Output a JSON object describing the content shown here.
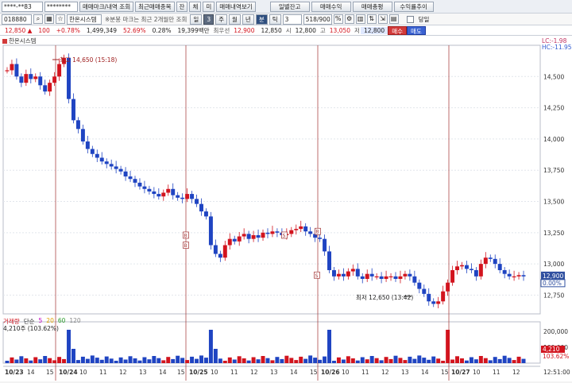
{
  "toolbar1": {
    "account_field": "****-**83",
    "password_field": "********",
    "btn_trade_mark": "매매마크/내역 조회",
    "btn_recent_trades": "최근매매종목",
    "btn_balance": "잔",
    "btn_holdings": "체",
    "btn_not": "미",
    "btn_trade_history": "매매내역보기",
    "btn_daily_balance": "일별잔고",
    "btn_trade_profit": "매매수익",
    "btn_trade_sum": "매매총평",
    "btn_profit_trend": "수익률추이"
  },
  "toolbar2": {
    "code_field": "018880",
    "stock_name": "한온시스템",
    "note": "※분봉 마크는 최근 2개월만 조회",
    "period_buttons": [
      "일",
      "3",
      "주",
      "월",
      "년",
      "분",
      "틱"
    ],
    "selected_period": "3",
    "minute_value": "3",
    "count_value": "518/900",
    "today_label": "당일"
  },
  "quote": {
    "price": "12,850 ▲",
    "change": "100",
    "change_pct": "+0.78%",
    "volume": "1,499,349",
    "turnover_pct": "52.69%",
    "ratio": "0.28%",
    "amount": "19,399백만",
    "best_ask_label": "최우선",
    "best_ask": "12,900",
    "prev_close": "12,850",
    "open_label": "시",
    "open": "12,800",
    "high_label": "고",
    "high": "13,050",
    "low_label": "저",
    "low": "12,800",
    "buy": "매수",
    "sell": "매도"
  },
  "chart": {
    "legend_name": "한온시스템",
    "lc": "LC:-1.98",
    "hc": "HC:-11.95",
    "high_annotation": "최고 14,650 (15:18)",
    "low_annotation": "최저 12,650 (13:42)",
    "current_price_tag": "12,900",
    "current_pct_tag": "0.00%",
    "y_ticks": [
      "14,500",
      "14,250",
      "14,000",
      "13,750",
      "13,500",
      "13,250",
      "13,000",
      "12,750"
    ],
    "vol_legend": {
      "name": "거래량",
      "ma_label": "단순",
      "ma": [
        "5",
        "20",
        "60",
        "120"
      ]
    },
    "vol_sub": "4,210주 (103.62%)",
    "vol_ticks": [
      "200,000",
      "100,000"
    ],
    "vol_tag_1": "4,210",
    "vol_tag_2": "103.62%",
    "time_tag": "12:51:00",
    "x_ticks": [
      "10/23",
      "14",
      "15",
      "10/24",
      "10",
      "11",
      "12",
      "13",
      "14",
      "15",
      "10/25",
      "10",
      "11",
      "12",
      "13",
      "14",
      "15",
      "10/26",
      "10",
      "11",
      "12",
      "13",
      "14",
      "15",
      "10/27",
      "10",
      "11",
      "12"
    ],
    "marker_labels": [
      "B",
      "S",
      "B",
      "S",
      "B"
    ]
  },
  "chart_data": {
    "type": "candlestick",
    "y_range": [
      12600,
      14750
    ],
    "day_separators": [
      "10/24",
      "10/25",
      "10/26",
      "10/27"
    ],
    "close_series": [
      14550,
      14600,
      14500,
      14450,
      14520,
      14480,
      14500,
      14430,
      14380,
      14450,
      14500,
      14600,
      14650,
      14320,
      14150,
      14080,
      13980,
      13920,
      13880,
      13850,
      13820,
      13800,
      13780,
      13760,
      13740,
      13700,
      13680,
      13650,
      13620,
      13600,
      13580,
      13560,
      13540,
      13570,
      13600,
      13550,
      13530,
      13520,
      13560,
      13520,
      13480,
      13420,
      13380,
      13150,
      13080,
      13050,
      13150,
      13200,
      13180,
      13220,
      13240,
      13200,
      13230,
      13210,
      13250,
      13240,
      13260,
      13250,
      13230,
      13240,
      13270,
      13280,
      13300,
      13260,
      13240,
      13210,
      13200,
      13100,
      12950,
      12900,
      12920,
      12900,
      12940,
      12960,
      12900,
      12880,
      12920,
      12900,
      12900,
      12880,
      12900,
      12900,
      12880,
      12900,
      12920,
      12900,
      12850,
      12800,
      12760,
      12700,
      12680,
      12700,
      12780,
      12850,
      12950,
      12980,
      12990,
      12960,
      12950,
      12900,
      13000,
      13050,
      13040,
      13000,
      12950,
      12920,
      12900,
      12900,
      12910,
      12900
    ]
  }
}
